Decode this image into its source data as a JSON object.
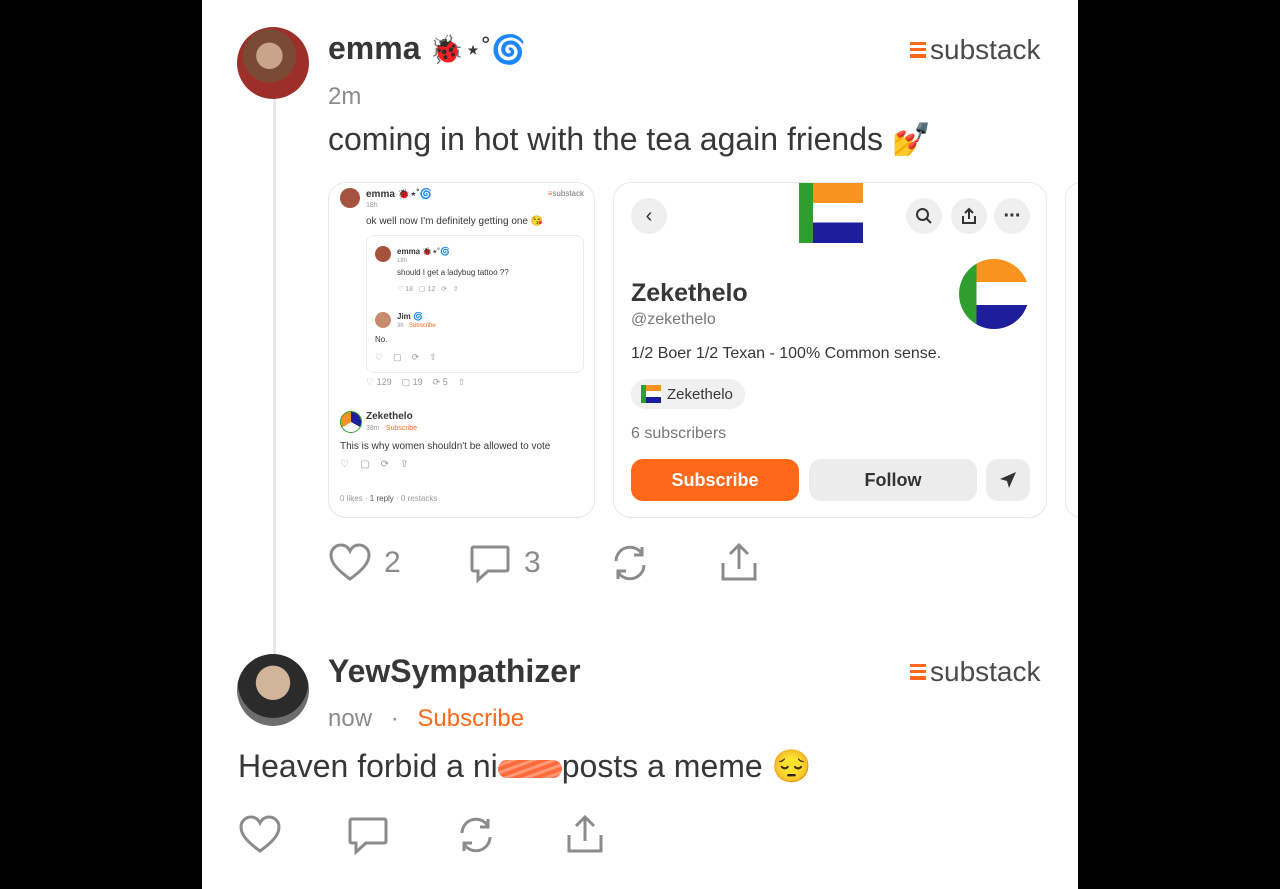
{
  "colors": {
    "accent": "#ff6719",
    "text": "#363737",
    "muted": "#8b8b8b",
    "flag_orange": "#f7931e",
    "flag_white": "#ffffff",
    "flag_blue": "#1e1e9c",
    "flag_green": "#2e9e2e"
  },
  "brand_label": "substack",
  "post": {
    "author": "emma",
    "author_emoji": "🐞⋆˚🌀",
    "time": "2m",
    "text": "coming in hot with the tea again friends 💅",
    "likes": "2",
    "comments": "3"
  },
  "screenshot_card": {
    "author": "emma 🐞⋆˚🌀",
    "time": "18h",
    "text": "ok well now I'm definitely getting one 😘",
    "brand": "substack",
    "nested_post": {
      "author": "emma 🐞⋆˚🌀",
      "time": "18h",
      "text": "should I get a ladybug tattoo ??",
      "likes": "18",
      "comments": "12"
    },
    "nested_reply": {
      "author": "Jim 🌀",
      "time": "3h",
      "subscribe": "Subscribe",
      "text": "No."
    },
    "stats": {
      "likes": "129",
      "comments": "19",
      "restacks": "5"
    },
    "zeke_reply": {
      "author": "Zekethelo",
      "time": "38m",
      "subscribe": "Subscribe",
      "text": "This is why women shouldn't be allowed to vote"
    },
    "footer": {
      "likes": "0 likes",
      "replies": "1 reply",
      "restacks": "0 restacks"
    }
  },
  "profile_card": {
    "name": "Zekethelo",
    "handle": "@zekethelo",
    "bio": "1/2 Boer 1/2 Texan - 100% Common sense.",
    "publication": "Zekethelo",
    "subscribers": "6 subscribers",
    "subscribe_button": "Subscribe",
    "follow_button": "Follow"
  },
  "reply": {
    "author": "YewSympathizer",
    "time": "now",
    "subscribe": "Subscribe",
    "text_before": "Heaven forbid a ni",
    "text_after": "posts a meme 😔"
  }
}
